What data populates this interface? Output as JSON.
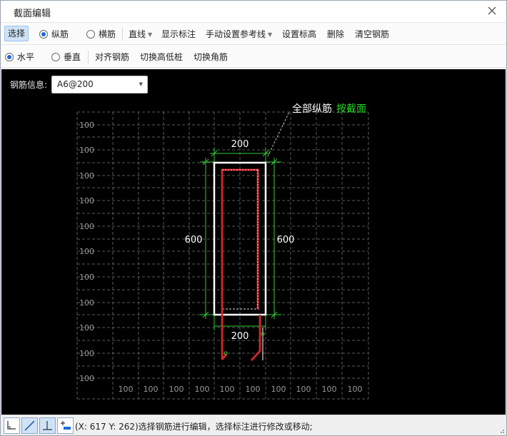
{
  "window": {
    "title": "截面编辑"
  },
  "toolbar1": {
    "select": "选择",
    "longitudinal": "纵筋",
    "transverse": "横筋",
    "line": "直线",
    "show_dims": "显示标注",
    "manual_ref": "手动设置参考线",
    "set_elevation": "设置标高",
    "delete": "删除",
    "clear_rebar": "清空钢筋"
  },
  "toolbar2": {
    "horizontal": "水平",
    "vertical": "垂直",
    "align_rebar": "对齐钢筋",
    "toggle_pile": "切换高低桩",
    "toggle_corner": "切换角筋"
  },
  "rebar": {
    "label": "钢筋信息:",
    "value": "A6@200"
  },
  "drawing": {
    "grid_label": "100",
    "dim_width": "200",
    "dim_height": "600",
    "note_prefix": "全部纵筋",
    "note_suffix": "按截面",
    "colors": {
      "background": "#000000",
      "grid": "#5a5a5a",
      "dimension": "#33cc33",
      "section": "#ffffff",
      "rebar": "#d8232a",
      "note_highlight": "#22dd22"
    }
  },
  "status": {
    "coords": "(X: 617 Y: 262)",
    "message": "选择钢筋进行编辑，选择标注进行修改或移动;"
  }
}
